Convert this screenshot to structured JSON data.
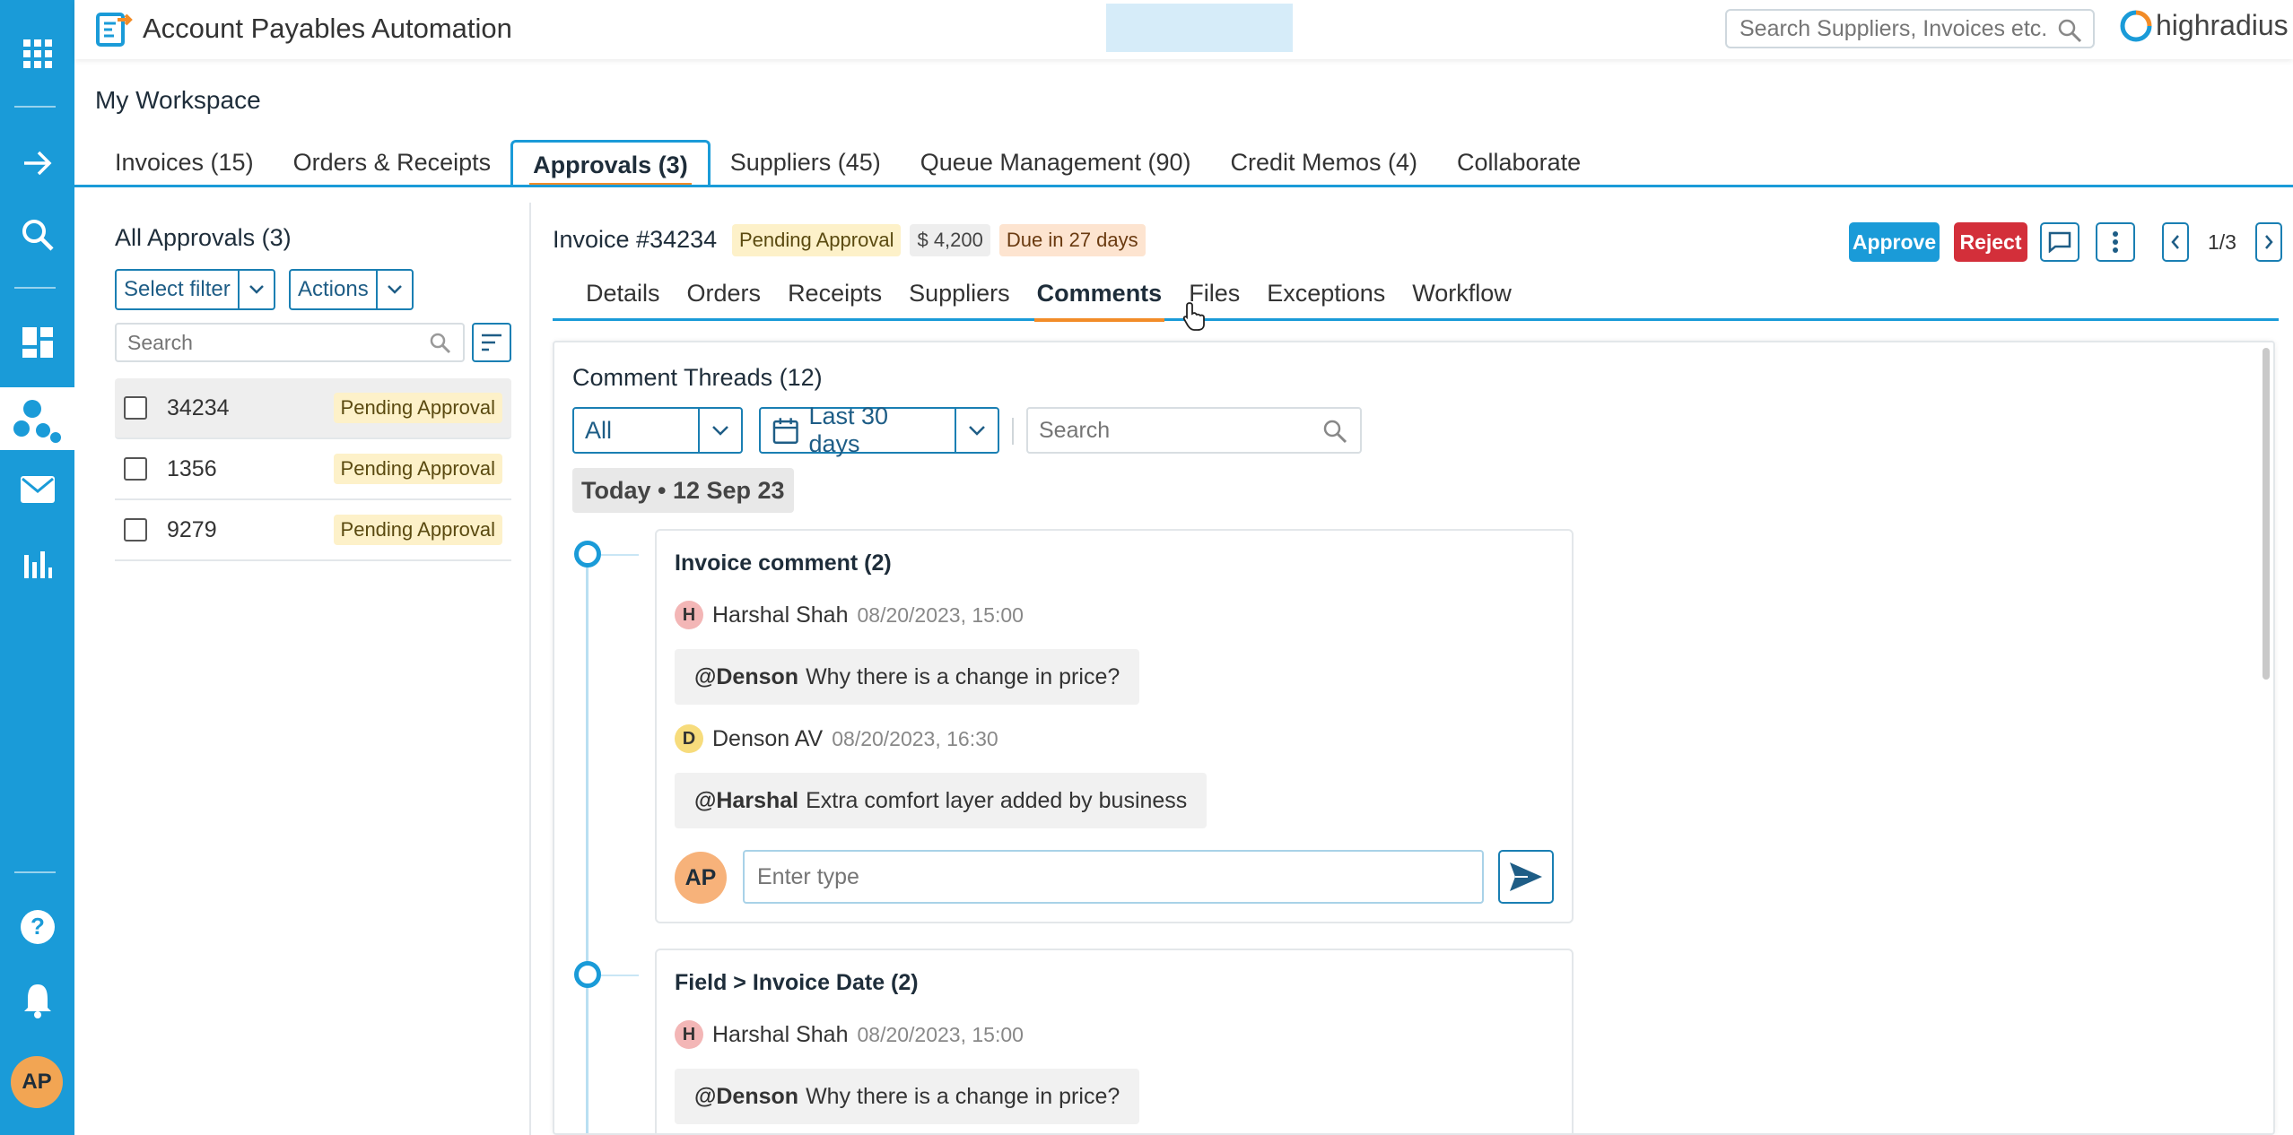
{
  "header": {
    "app_title": "Account Payables Automation",
    "search_placeholder": "Search Suppliers, Invoices etc.",
    "brand": "highradius"
  },
  "sidebar": {
    "icons": [
      "apps-grid-icon",
      "arrow-right-icon",
      "search-icon",
      "dashboard-icon",
      "workflow-icon",
      "mail-icon",
      "reports-icon",
      "help-icon",
      "bell-icon"
    ],
    "user_initials": "AP",
    "accent_color": "#1a9bd8"
  },
  "workspace": {
    "title": "My Workspace",
    "tabs": [
      {
        "label": "Invoices (15)"
      },
      {
        "label": "Orders & Receipts"
      },
      {
        "label": "Approvals (3)",
        "active": true
      },
      {
        "label": "Suppliers (45)"
      },
      {
        "label": "Queue Management (90)"
      },
      {
        "label": "Credit Memos (4)"
      },
      {
        "label": "Collaborate"
      }
    ]
  },
  "approvals_list": {
    "title": "All Approvals (3)",
    "filter_label": "Select filter",
    "actions_label": "Actions",
    "search_placeholder": "Search",
    "rows": [
      {
        "number": "34234",
        "status": "Pending Approval",
        "selected": true
      },
      {
        "number": "1356",
        "status": "Pending Approval"
      },
      {
        "number": "9279",
        "status": "Pending Approval"
      }
    ]
  },
  "invoice": {
    "title": "Invoice #34234",
    "status": "Pending Approval",
    "amount": "$ 4,200",
    "due": "Due in 27 days",
    "approve_label": "Approve",
    "reject_label": "Reject",
    "pager": "1/3",
    "tabs": [
      {
        "label": "Details"
      },
      {
        "label": "Orders"
      },
      {
        "label": "Receipts"
      },
      {
        "label": "Suppliers"
      },
      {
        "label": "Comments",
        "active": true
      },
      {
        "label": "Files"
      },
      {
        "label": "Exceptions"
      },
      {
        "label": "Workflow"
      }
    ]
  },
  "comments": {
    "title": "Comment Threads (12)",
    "type_filter": "All",
    "date_filter": "Last 30 days",
    "search_placeholder": "Search",
    "date_group": "Today • 12 Sep 23",
    "threads": [
      {
        "title": "Invoice comment (2)",
        "messages": [
          {
            "initial": "H",
            "author": "Harshal Shah",
            "timestamp": "08/20/2023, 15:00",
            "mention": "@Denson",
            "text": "Why there is a change in price?"
          },
          {
            "initial": "D",
            "author": "Denson AV",
            "timestamp": "08/20/2023, 16:30",
            "mention": "@Harshal",
            "text": "Extra comfort layer added by business"
          }
        ],
        "reply_initials": "AP",
        "reply_placeholder": "Enter type"
      },
      {
        "title": "Field > Invoice Date (2)",
        "messages": [
          {
            "initial": "H",
            "author": "Harshal Shah",
            "timestamp": "08/20/2023, 15:00",
            "mention": "@Denson",
            "text": "Why there is a change in price?"
          }
        ]
      }
    ]
  }
}
